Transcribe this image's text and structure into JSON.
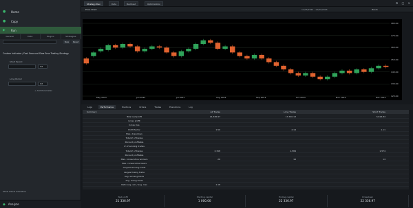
{
  "left_panel": {
    "items": [
      {
        "label": "Home",
        "icon": "home-icon"
      },
      {
        "label": "Copy",
        "icon": "copy-icon"
      },
      {
        "label": "Run",
        "icon": "run-icon"
      }
    ],
    "subtabs": [
      "General",
      "Data",
      "Plugins",
      "Strategies"
    ],
    "filter_placeholder": "",
    "buttons": [
      "New",
      "Reset"
    ],
    "strategy_title": "Custom Indicator / Fast Sma and Slow Sma Trading Strategy",
    "fields": [
      {
        "label": "Short Period",
        "value": "",
        "unit": "Int"
      },
      {
        "label": "Long Period",
        "value": "",
        "unit": "Int"
      }
    ],
    "add_label": "+ Add Parameter",
    "option_label": "Show Visual Indicators",
    "footer": "Analyze"
  },
  "topbar": {
    "tabs": [
      "Strategy Dev",
      "Data",
      "Backtest",
      "Optimization"
    ],
    "icons": "⚙ □ ✕"
  },
  "chart_header": {
    "title": "Price Chart",
    "range_label": "11/15/2022 - 12/31/2023",
    "zoom": "Zoom"
  },
  "chart_data": {
    "type": "candlestick",
    "title": "",
    "ylim": [
      125,
      185
    ],
    "yticks": [
      "185.00",
      "175.00",
      "165.00",
      "155.00",
      "145.00",
      "135.00",
      "125.00"
    ],
    "xticks": [
      "May 2023",
      "Jun 2023",
      "Jul 2023",
      "Aug 2023",
      "Sep 2023",
      "Oct 2023",
      "Nov 2023",
      "Dec 2023"
    ],
    "candles": [
      {
        "o": 156,
        "c": 152
      },
      {
        "o": 158,
        "c": 161
      },
      {
        "o": 162,
        "c": 164
      },
      {
        "o": 163,
        "c": 167
      },
      {
        "o": 167,
        "c": 165
      },
      {
        "o": 165,
        "c": 168
      },
      {
        "o": 168,
        "c": 166
      },
      {
        "o": 166,
        "c": 162
      },
      {
        "o": 162,
        "c": 164
      },
      {
        "o": 164,
        "c": 166
      },
      {
        "o": 166,
        "c": 165
      },
      {
        "o": 165,
        "c": 161
      },
      {
        "o": 161,
        "c": 158
      },
      {
        "o": 158,
        "c": 162
      },
      {
        "o": 162,
        "c": 164
      },
      {
        "o": 164,
        "c": 168
      },
      {
        "o": 168,
        "c": 171
      },
      {
        "o": 171,
        "c": 169
      },
      {
        "o": 169,
        "c": 164
      },
      {
        "o": 164,
        "c": 166
      },
      {
        "o": 166,
        "c": 161
      },
      {
        "o": 161,
        "c": 158
      },
      {
        "o": 158,
        "c": 156
      },
      {
        "o": 156,
        "c": 159
      },
      {
        "o": 159,
        "c": 156
      },
      {
        "o": 156,
        "c": 153
      },
      {
        "o": 153,
        "c": 150
      },
      {
        "o": 150,
        "c": 147
      },
      {
        "o": 147,
        "c": 144
      },
      {
        "o": 144,
        "c": 142
      },
      {
        "o": 142,
        "c": 144
      },
      {
        "o": 144,
        "c": 141
      },
      {
        "o": 141,
        "c": 139
      },
      {
        "o": 139,
        "c": 141
      },
      {
        "o": 141,
        "c": 144
      },
      {
        "o": 144,
        "c": 146
      },
      {
        "o": 146,
        "c": 144
      },
      {
        "o": 144,
        "c": 147
      },
      {
        "o": 147,
        "c": 145
      },
      {
        "o": 145,
        "c": 148
      },
      {
        "o": 148,
        "c": 150
      },
      {
        "o": 150,
        "c": 149
      }
    ],
    "grid": true
  },
  "bottom_tabs": [
    "Logs",
    "Performance",
    "Positions",
    "Orders",
    "Trades",
    "Executions",
    "Log"
  ],
  "perf_table": {
    "headers": [
      "Summary",
      "All Trades",
      "Long Trades",
      "Short Trades"
    ],
    "rows": [
      [
        "Total net profit",
        "21,336.97",
        "17,720.13",
        "3,616.84"
      ],
      [
        "Gross profit",
        "",
        "",
        ""
      ],
      [
        "Gross loss",
        "",
        "",
        ""
      ],
      [
        "Profit factor",
        "1.50",
        "2.14",
        "1.11"
      ],
      [
        "Max. drawdown",
        "",
        "",
        ""
      ],
      [
        "Total # of trades",
        "",
        "",
        ""
      ],
      [
        "Percent profitable",
        "",
        "",
        ""
      ],
      [
        "# of winning trades",
        "",
        "",
        ""
      ],
      [
        "Total # of trades",
        "3,158",
        "1,584",
        "1,574"
      ],
      [
        "Percent profitable",
        "",
        "",
        ""
      ],
      [
        "Max. consecutive winners",
        "26",
        "16",
        "14"
      ],
      [
        "Max. consecutive losers",
        "",
        "",
        ""
      ],
      [
        "Largest winning trade",
        "",
        "",
        ""
      ],
      [
        "Largest losing trade",
        "",
        "",
        ""
      ],
      [
        "Avg. winning trade",
        "",
        "",
        ""
      ],
      [
        "Avg. losing trade",
        "",
        "",
        ""
      ],
      [
        "Ratio avg. win / avg. loss",
        "1.18",
        "",
        ""
      ]
    ]
  },
  "summary_cards": [
    {
      "label": "Net profit",
      "value": "21 336.97"
    },
    {
      "label": "Starting capital",
      "value": "1 000.00"
    },
    {
      "label": "Ending capital",
      "value": "22 336.97"
    },
    {
      "label": "Drawdown",
      "value": "22 336.97"
    }
  ]
}
